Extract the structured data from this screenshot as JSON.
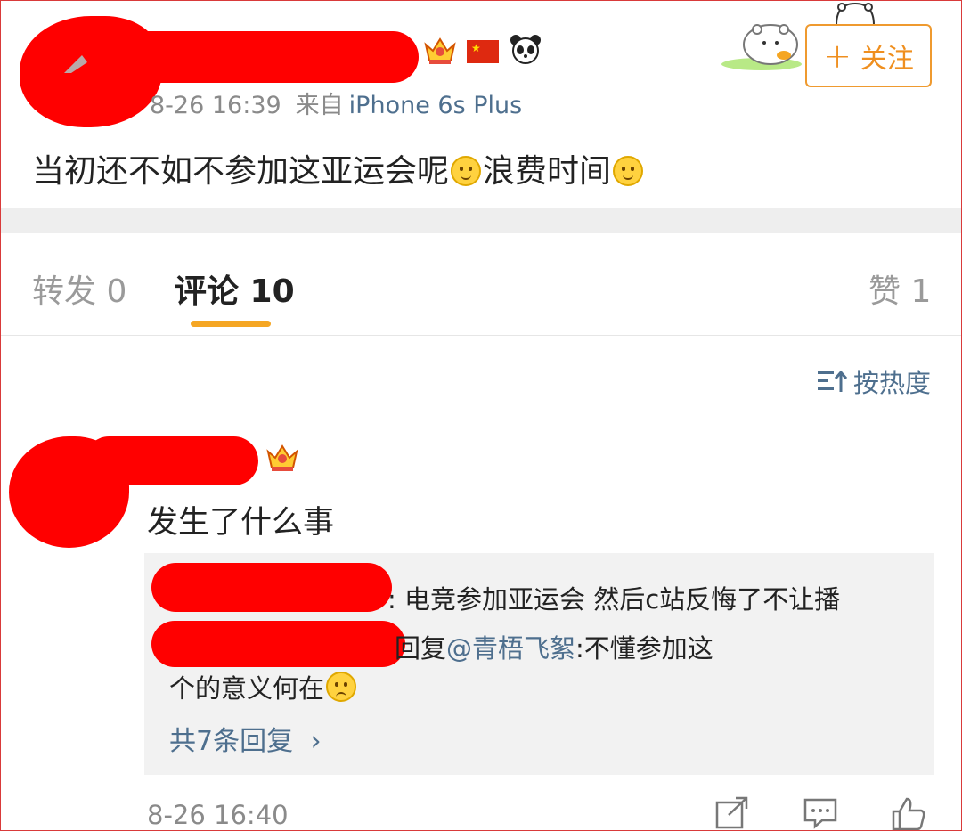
{
  "post": {
    "time": "8-26 16:39",
    "source_prefix": "来自",
    "device": "iPhone 6s Plus",
    "text_a": "当初还不如不参加这亚运会呢",
    "text_b": "浪费时间",
    "follow_label": "关注",
    "follow_plus": "+"
  },
  "tabs": {
    "repost": "转发 0",
    "comments": "评论 10",
    "likes": "赞 1"
  },
  "sort_label": "按热度",
  "comment": {
    "text": "发生了什么事",
    "reply1": ": 电竞参加亚运会 然后c站反悔了不让播",
    "reply2_prefix": "回复",
    "reply2_mention": "@青梧飞絮",
    "reply2_suffix": ":不懂参加这",
    "reply3": "个的意义何在",
    "more_replies": "共7条回复",
    "more_chevron": "›",
    "time": "8-26 16:40"
  },
  "icons": [
    "crown-vip-icon",
    "china-flag-icon",
    "panda-icon",
    "smile-emoji-icon",
    "sad-emoji-icon",
    "sort-icon",
    "share-icon",
    "comment-icon",
    "like-icon"
  ],
  "colors": {
    "accent_orange": "#ef8f1f",
    "link_blue": "#4e6f8e",
    "redaction": "#ff0000"
  }
}
